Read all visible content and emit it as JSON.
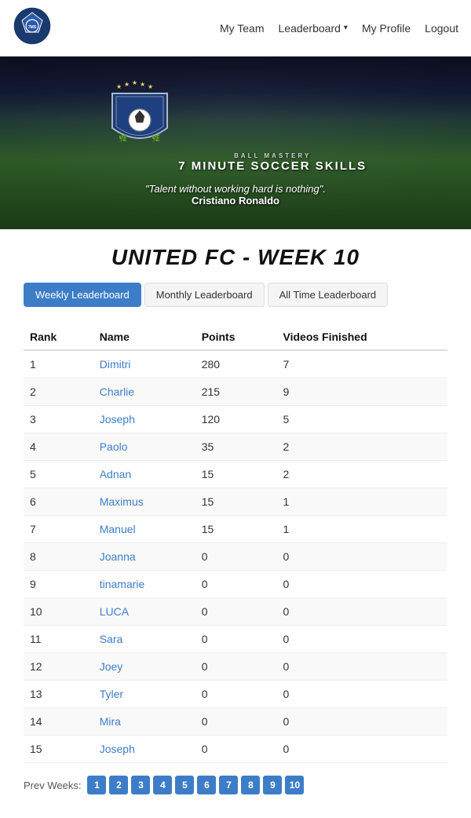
{
  "nav": {
    "links": [
      {
        "label": "My Team",
        "name": "my-team-link"
      },
      {
        "label": "Leaderboard",
        "name": "leaderboard-link",
        "hasDropdown": true
      },
      {
        "label": "My Profile",
        "name": "my-profile-link"
      },
      {
        "label": "Logout",
        "name": "logout-link"
      }
    ]
  },
  "hero": {
    "brand_top": "7 MINUTE SOCCER SKILLS",
    "quote": "\"Talent without working hard is nothing\".",
    "quote_author": "Cristiano Ronaldo"
  },
  "page": {
    "title": "UNITED FC - WEEK 10"
  },
  "tabs": [
    {
      "label": "Weekly Leaderboard",
      "active": true,
      "name": "weekly-tab"
    },
    {
      "label": "Monthly Leaderboard",
      "active": false,
      "name": "monthly-tab"
    },
    {
      "label": "All Time Leaderboard",
      "active": false,
      "name": "alltime-tab"
    }
  ],
  "table": {
    "headers": [
      "Rank",
      "Name",
      "Points",
      "Videos Finished"
    ],
    "rows": [
      {
        "rank": 1,
        "name": "Dimitri",
        "points": 280,
        "videos": 7
      },
      {
        "rank": 2,
        "name": "Charlie",
        "points": 215,
        "videos": 9
      },
      {
        "rank": 3,
        "name": "Joseph",
        "points": 120,
        "videos": 5
      },
      {
        "rank": 4,
        "name": "Paolo",
        "points": 35,
        "videos": 2
      },
      {
        "rank": 5,
        "name": "Adnan",
        "points": 15,
        "videos": 2
      },
      {
        "rank": 6,
        "name": "Maximus",
        "points": 15,
        "videos": 1
      },
      {
        "rank": 7,
        "name": "Manuel",
        "points": 15,
        "videos": 1
      },
      {
        "rank": 8,
        "name": "Joanna",
        "points": 0,
        "videos": 0
      },
      {
        "rank": 9,
        "name": "tinamarie",
        "points": 0,
        "videos": 0
      },
      {
        "rank": 10,
        "name": "LUCA",
        "points": 0,
        "videos": 0
      },
      {
        "rank": 11,
        "name": "Sara",
        "points": 0,
        "videos": 0
      },
      {
        "rank": 12,
        "name": "Joey",
        "points": 0,
        "videos": 0
      },
      {
        "rank": 13,
        "name": "Tyler",
        "points": 0,
        "videos": 0
      },
      {
        "rank": 14,
        "name": "Mira",
        "points": 0,
        "videos": 0
      },
      {
        "rank": 15,
        "name": "Joseph",
        "points": 0,
        "videos": 0
      }
    ]
  },
  "pagination": {
    "label": "Prev Weeks:",
    "pages": [
      1,
      2,
      3,
      4,
      5,
      6,
      7,
      8,
      9,
      10
    ]
  }
}
